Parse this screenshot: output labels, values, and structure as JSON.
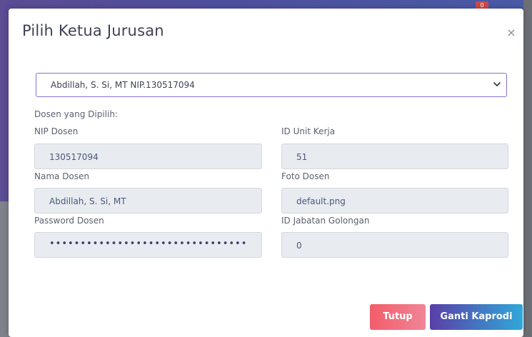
{
  "modal": {
    "title": "Pilih Ketua Jurusan",
    "close_symbol": "×"
  },
  "select": {
    "value": "Abdillah, S. Si, MT NIP.130517094"
  },
  "form": {
    "section_label": "Dosen yang Dipilih:",
    "nip_label": "NIP Dosen",
    "nip_value": "130517094",
    "unit_label": "ID Unit Kerja",
    "unit_value": "51",
    "nama_label": "Nama Dosen",
    "nama_value": "Abdillah, S. Si, MT",
    "foto_label": "Foto Dosen",
    "foto_value": "default.png",
    "password_label": "Password Dosen",
    "password_value": "••••••••••••••••••••••••••••••••",
    "jabatan_label": "ID Jabatan Golongan",
    "jabatan_value": "0"
  },
  "buttons": {
    "close_label": "Tutup",
    "submit_label": "Ganti Kaprodi"
  },
  "badge": {
    "count": "0"
  },
  "colors": {
    "select_border": "#8b6fcf",
    "close_button": "#f25c6a",
    "submit_button_start": "#5a3fa8",
    "submit_button_end": "#2fa8d8"
  },
  "icons": {
    "close": "close-icon",
    "select_caret": "chevron-down-icon"
  }
}
